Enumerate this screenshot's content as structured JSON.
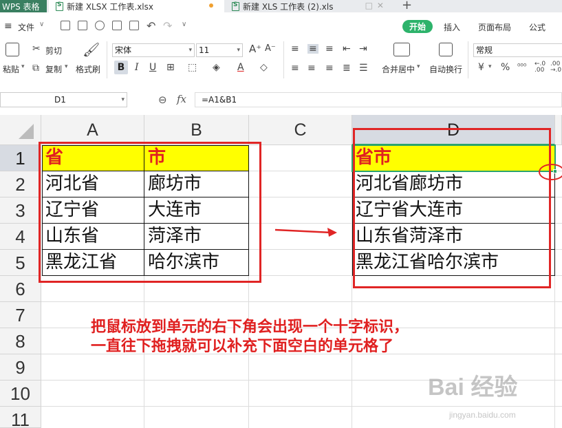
{
  "app": {
    "name": "WPS 表格"
  },
  "tabs": [
    {
      "label": "新建 XLSX 工作表.xlsx",
      "active": true
    },
    {
      "label": "新建 XLS 工作表 (2).xls",
      "active": false
    }
  ],
  "menu": {
    "file": "文件",
    "ribbon_tabs": [
      "开始",
      "插入",
      "页面布局",
      "公式"
    ],
    "active_tab": "开始"
  },
  "ribbon": {
    "paste": "粘贴",
    "cut": "剪切",
    "copy": "复制",
    "format_painter": "格式刷",
    "font_name": "宋体",
    "font_size": "11",
    "merge_center": "合并居中",
    "wrap_text": "自动换行",
    "number_format": "常规",
    "currency_symbol": "¥",
    "percent_symbol": "%"
  },
  "formula_bar": {
    "name_box": "D1",
    "fx": "fx",
    "formula": "=A1&B1"
  },
  "columns": [
    "A",
    "B",
    "C",
    "D"
  ],
  "rows": [
    "1",
    "2",
    "3",
    "4",
    "5",
    "6",
    "7",
    "8",
    "9",
    "10",
    "11"
  ],
  "cells": {
    "A": [
      "省",
      "河北省",
      "辽宁省",
      "山东省",
      "黑龙江省"
    ],
    "B": [
      "市",
      "廊坊市",
      "大连市",
      "菏泽市",
      "哈尔滨市"
    ],
    "D": [
      "省市",
      "河北省廊坊市",
      "辽宁省大连市",
      "山东省菏泽市",
      "黑龙江省哈尔滨市"
    ]
  },
  "selected_cell": "D1",
  "annotation": {
    "line1": "把鼠标放到单元的右下角会出现一个十字标识，",
    "line2": "一直往下拖拽就可以补充下面空白的单元格了"
  },
  "watermark": {
    "brand": "Bai 经验",
    "url": "jingyan.baidu.com"
  },
  "colors": {
    "accent_green": "#2db36b",
    "header_fill": "#ffff00",
    "header_text": "#e02020",
    "annotation_red": "#e02525"
  }
}
